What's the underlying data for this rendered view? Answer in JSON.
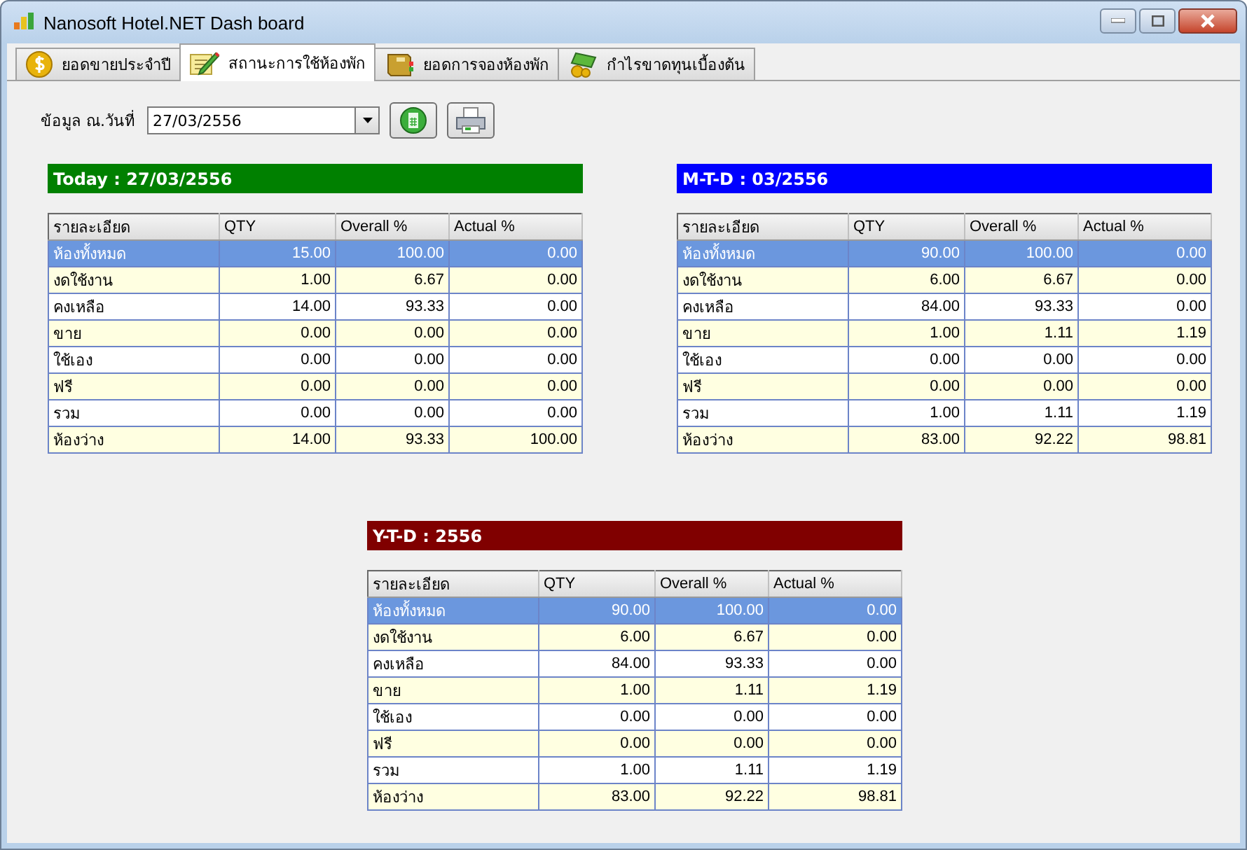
{
  "window": {
    "title": "Nanosoft Hotel.NET Dash board"
  },
  "tabs": [
    {
      "label": "ยอดขายประจำปี",
      "kind": "coin",
      "selected": false
    },
    {
      "label": "สถานะการใช้ห้องพัก",
      "kind": "notepad",
      "selected": true
    },
    {
      "label": "ยอดการจองห้องพัก",
      "kind": "book",
      "selected": false
    },
    {
      "label": "กำไรขาดทุนเบื้องต้น",
      "kind": "money",
      "selected": false
    }
  ],
  "date_field": {
    "label": "ข้อมูล ณ.วันที่",
    "value": "27/03/2556"
  },
  "panels": [
    {
      "title": "Today : 27/03/2556",
      "color": "#008000",
      "columns": [
        "รายละเอียด",
        "QTY",
        "Overall %",
        "Actual %"
      ],
      "rows": [
        {
          "cells": [
            "ห้องทั้งหมด",
            "15.00",
            "100.00",
            "0.00"
          ],
          "selected": true
        },
        {
          "cells": [
            "งดใช้งาน",
            "1.00",
            "6.67",
            "0.00"
          ],
          "selected": false
        },
        {
          "cells": [
            "คงเหลือ",
            "14.00",
            "93.33",
            "0.00"
          ],
          "selected": false
        },
        {
          "cells": [
            "ขาย",
            "0.00",
            "0.00",
            "0.00"
          ],
          "selected": false
        },
        {
          "cells": [
            "ใช้เอง",
            "0.00",
            "0.00",
            "0.00"
          ],
          "selected": false
        },
        {
          "cells": [
            "ฟรี",
            "0.00",
            "0.00",
            "0.00"
          ],
          "selected": false
        },
        {
          "cells": [
            "รวม",
            "0.00",
            "0.00",
            "0.00"
          ],
          "selected": false
        },
        {
          "cells": [
            "ห้องว่าง",
            "14.00",
            "93.33",
            "100.00"
          ],
          "selected": false
        }
      ]
    },
    {
      "title": "M-T-D : 03/2556",
      "color": "#0000ff",
      "columns": [
        "รายละเอียด",
        "QTY",
        "Overall %",
        "Actual %"
      ],
      "rows": [
        {
          "cells": [
            "ห้องทั้งหมด",
            "90.00",
            "100.00",
            "0.00"
          ],
          "selected": true
        },
        {
          "cells": [
            "งดใช้งาน",
            "6.00",
            "6.67",
            "0.00"
          ],
          "selected": false
        },
        {
          "cells": [
            "คงเหลือ",
            "84.00",
            "93.33",
            "0.00"
          ],
          "selected": false
        },
        {
          "cells": [
            "ขาย",
            "1.00",
            "1.11",
            "1.19"
          ],
          "selected": false
        },
        {
          "cells": [
            "ใช้เอง",
            "0.00",
            "0.00",
            "0.00"
          ],
          "selected": false
        },
        {
          "cells": [
            "ฟรี",
            "0.00",
            "0.00",
            "0.00"
          ],
          "selected": false
        },
        {
          "cells": [
            "รวม",
            "1.00",
            "1.11",
            "1.19"
          ],
          "selected": false
        },
        {
          "cells": [
            "ห้องว่าง",
            "83.00",
            "92.22",
            "98.81"
          ],
          "selected": false
        }
      ]
    },
    {
      "title": "Y-T-D : 2556",
      "color": "#800000",
      "columns": [
        "รายละเอียด",
        "QTY",
        "Overall %",
        "Actual %"
      ],
      "rows": [
        {
          "cells": [
            "ห้องทั้งหมด",
            "90.00",
            "100.00",
            "0.00"
          ],
          "selected": true
        },
        {
          "cells": [
            "งดใช้งาน",
            "6.00",
            "6.67",
            "0.00"
          ],
          "selected": false
        },
        {
          "cells": [
            "คงเหลือ",
            "84.00",
            "93.33",
            "0.00"
          ],
          "selected": false
        },
        {
          "cells": [
            "ขาย",
            "1.00",
            "1.11",
            "1.19"
          ],
          "selected": false
        },
        {
          "cells": [
            "ใช้เอง",
            "0.00",
            "0.00",
            "0.00"
          ],
          "selected": false
        },
        {
          "cells": [
            "ฟรี",
            "0.00",
            "0.00",
            "0.00"
          ],
          "selected": false
        },
        {
          "cells": [
            "รวม",
            "1.00",
            "1.11",
            "1.19"
          ],
          "selected": false
        },
        {
          "cells": [
            "ห้องว่าง",
            "83.00",
            "92.22",
            "98.81"
          ],
          "selected": false
        }
      ]
    }
  ]
}
